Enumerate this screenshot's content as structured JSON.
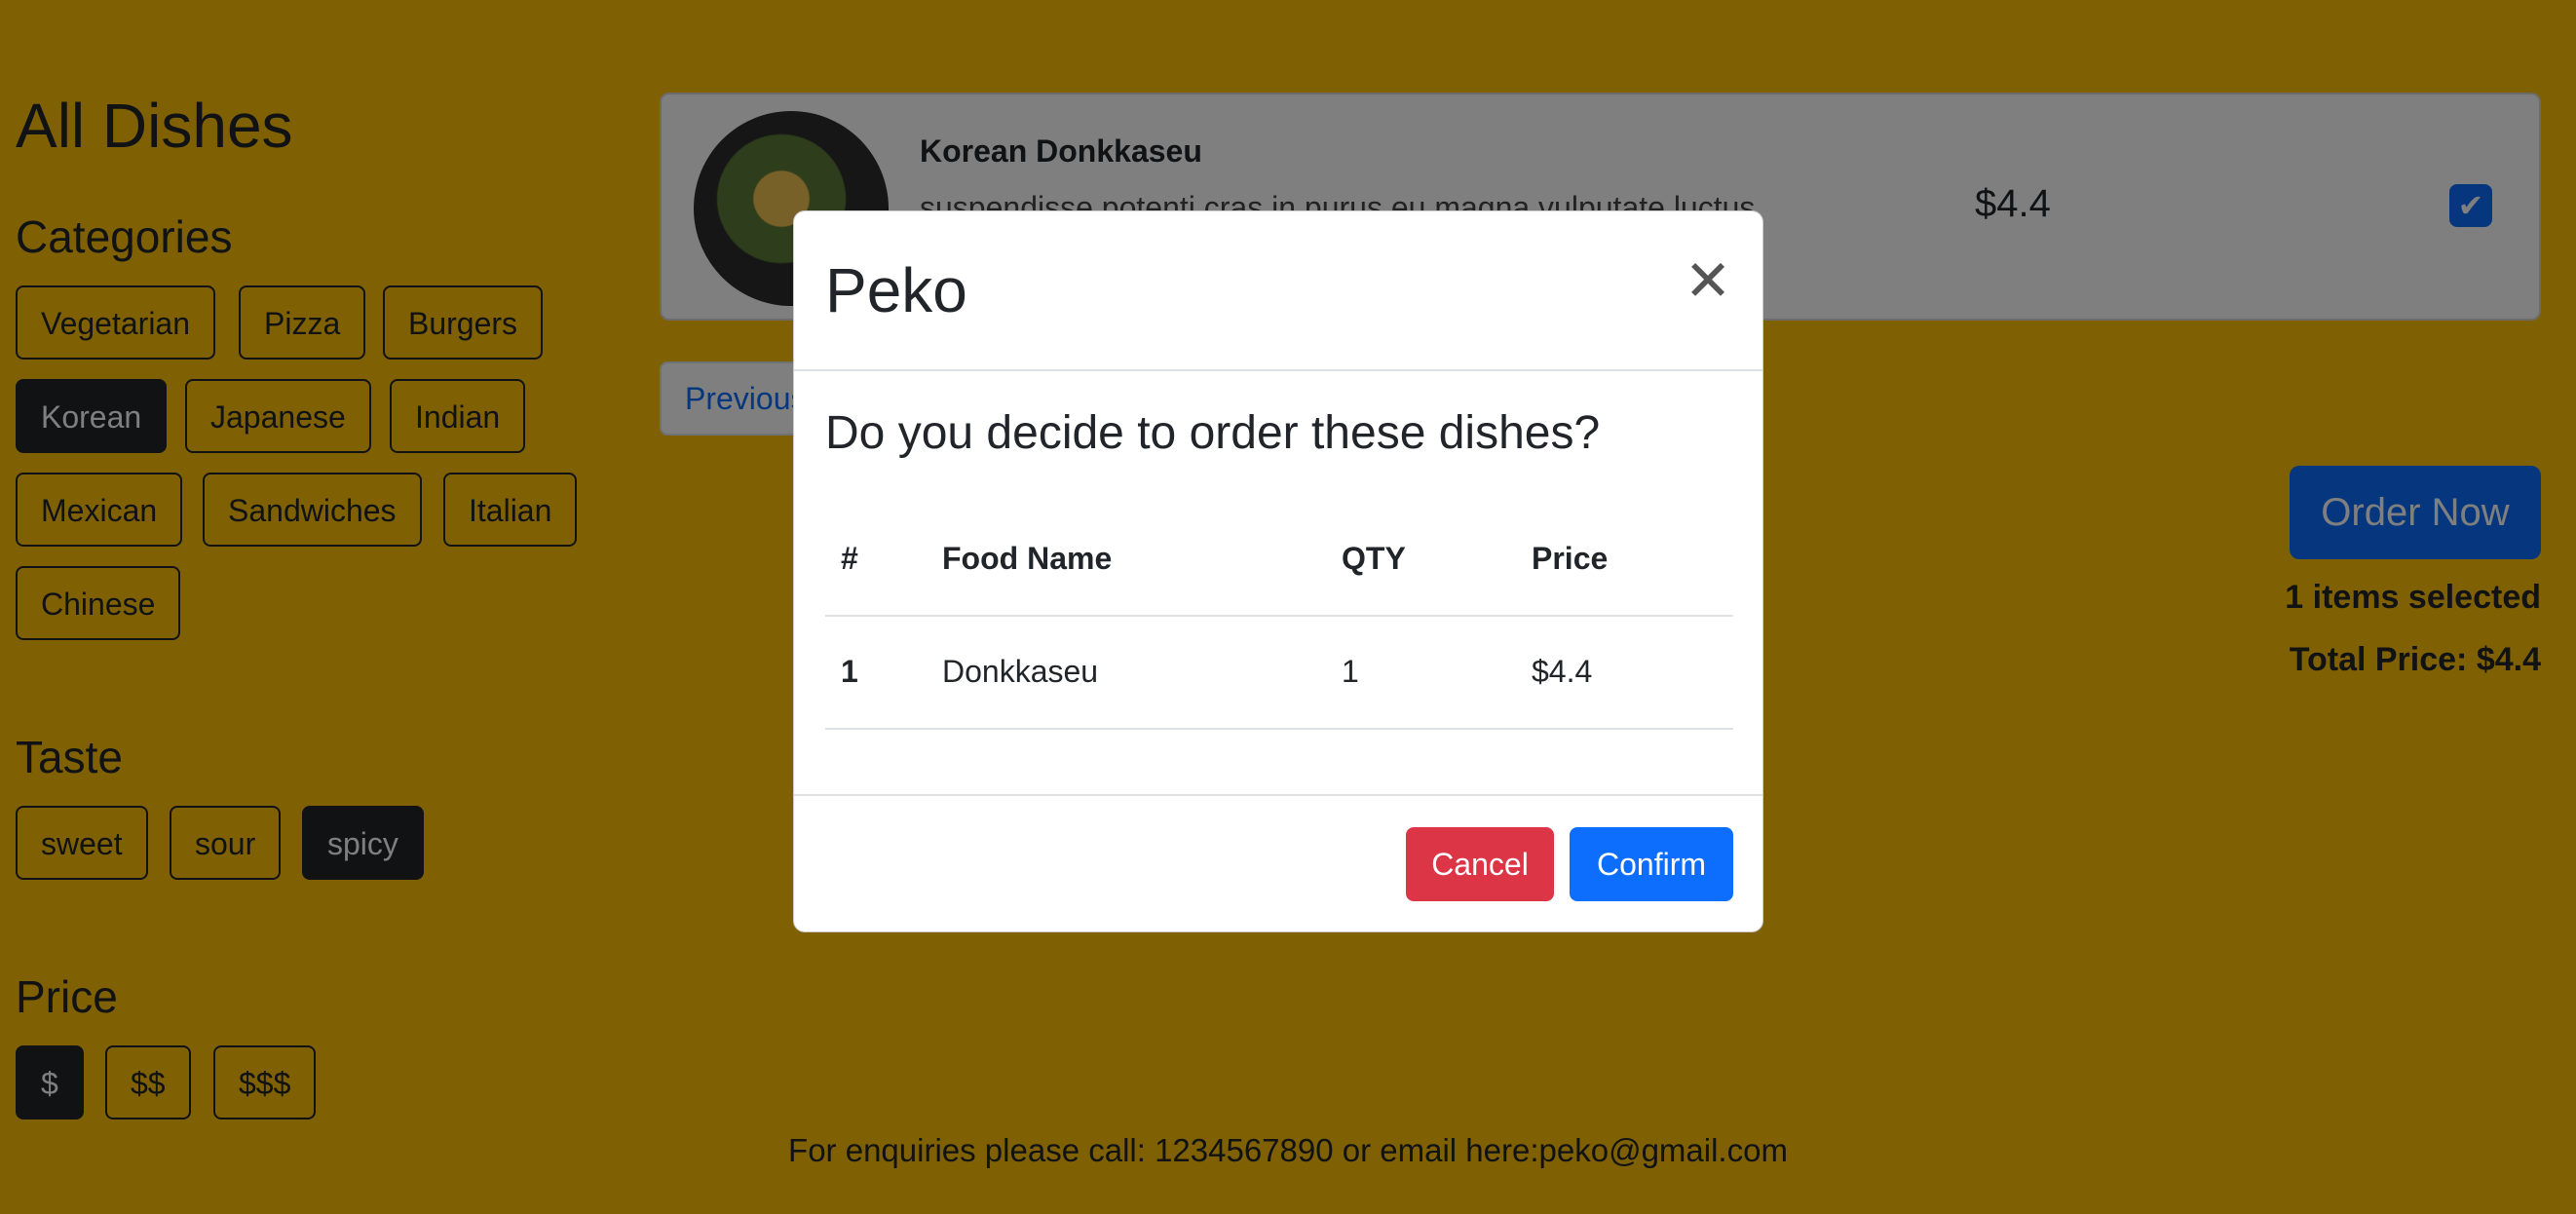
{
  "page": {
    "title": "All Dishes"
  },
  "sidebar": {
    "categories_heading": "Categories",
    "categories": [
      {
        "label": "Vegetarian",
        "active": false
      },
      {
        "label": "Pizza",
        "active": false
      },
      {
        "label": "Burgers",
        "active": false
      },
      {
        "label": "Korean",
        "active": true
      },
      {
        "label": "Japanese",
        "active": false
      },
      {
        "label": "Indian",
        "active": false
      },
      {
        "label": "Mexican",
        "active": false
      },
      {
        "label": "Sandwiches",
        "active": false
      },
      {
        "label": "Italian",
        "active": false
      },
      {
        "label": "Chinese",
        "active": false
      }
    ],
    "taste_heading": "Taste",
    "tastes": [
      {
        "label": "sweet",
        "active": false
      },
      {
        "label": "sour",
        "active": false
      },
      {
        "label": "spicy",
        "active": true
      }
    ],
    "price_heading": "Price",
    "prices": [
      {
        "label": "$",
        "active": true
      },
      {
        "label": "$$",
        "active": false
      },
      {
        "label": "$$$",
        "active": false
      }
    ]
  },
  "dish_card": {
    "name": "Korean  Donkkaseu",
    "description": "suspendisse potenti cras in purus eu magna vulputate luctus",
    "price": "$4.4",
    "selected": true,
    "check_icon": "check-icon"
  },
  "pager": {
    "previous_label": "Previous"
  },
  "order": {
    "button_label": "Order Now",
    "items_selected": "1 items selected",
    "total_price": "Total Price: $4.4"
  },
  "footer": {
    "text": "For enquiries please call: 1234567890 or email here:peko@gmail.com"
  },
  "modal": {
    "title": "Peko",
    "close_icon": "close-icon",
    "question": "Do you decide to order these dishes?",
    "table": {
      "headers": [
        "#",
        "Food Name",
        "QTY",
        "Price"
      ],
      "rows": [
        [
          "1",
          "Donkkaseu",
          "1",
          "$4.4"
        ]
      ]
    },
    "cancel_label": "Cancel",
    "confirm_label": "Confirm"
  },
  "colors": {
    "background": "#ffc107",
    "primary": "#0d6efd",
    "danger": "#dc3545",
    "dark": "#212529"
  }
}
